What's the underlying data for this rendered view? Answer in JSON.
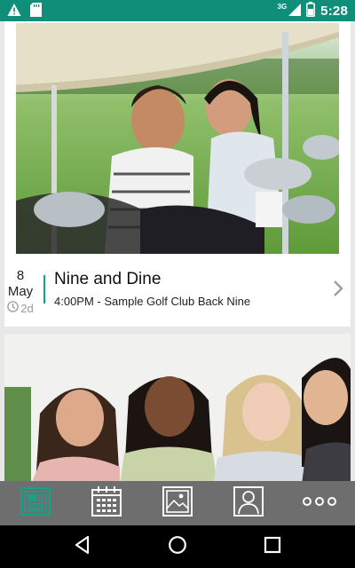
{
  "status_bar": {
    "time": "5:28",
    "network_type": "3G",
    "icons": [
      "warning-icon",
      "sd-card-icon",
      "signal-icon",
      "battery-icon"
    ]
  },
  "feed": {
    "events": [
      {
        "day": "8",
        "month": "May",
        "ago": "2d",
        "title": "Nine and Dine",
        "subtitle": "4:00PM - Sample Golf Club Back Nine",
        "image": "golf-cart-photo"
      },
      {
        "image": "group-of-women-photo"
      }
    ]
  },
  "tab_bar": {
    "tabs": [
      {
        "icon": "newsfeed-icon",
        "active": true
      },
      {
        "icon": "calendar-icon",
        "active": false
      },
      {
        "icon": "gallery-icon",
        "active": false
      },
      {
        "icon": "profile-icon",
        "active": false
      },
      {
        "icon": "more-icon",
        "active": false
      }
    ],
    "active_color": "#17a08a"
  },
  "nav_bar": {
    "buttons": [
      "back-icon",
      "home-icon",
      "recents-icon"
    ]
  }
}
